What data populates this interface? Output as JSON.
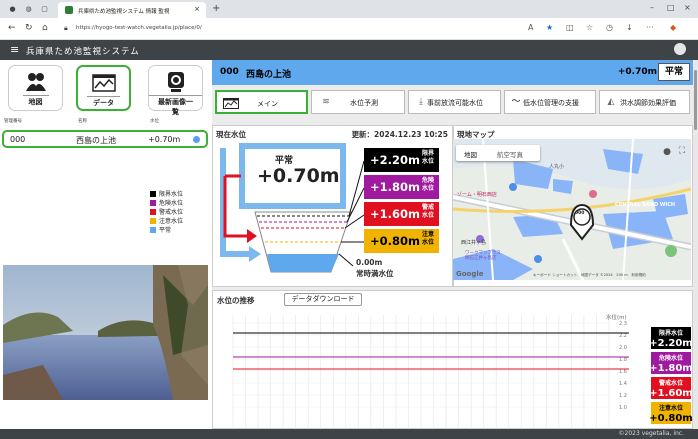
{
  "browser": {
    "tab_title": "兵庫県ため池監視システム 情報 監視",
    "url": "https://hyogo-test-watch.vegetalia.jp/place/0/",
    "url_prefix": "https://",
    "url_host": "hyogo-test-watch.vegetalia.jp/place/0/"
  },
  "app": {
    "title": "兵庫県ため池監視システム"
  },
  "left_nav": {
    "buttons": [
      {
        "label": "地図",
        "icon": "people-map-icon"
      },
      {
        "label": "データ",
        "icon": "data-chart-icon"
      },
      {
        "label": "最新画像一覧",
        "icon": "camera-icon"
      }
    ],
    "columns": [
      "管理番号",
      "名称",
      "水位"
    ],
    "row": {
      "id": "000",
      "name": "西島の上池",
      "level": "+0.70m"
    }
  },
  "legend": [
    {
      "label": "限界水位",
      "color": "#000000"
    },
    {
      "label": "危険水位",
      "color": "#a01aa0"
    },
    {
      "label": "警戒水位",
      "color": "#e01020"
    },
    {
      "label": "注意水位",
      "color": "#f0b400"
    },
    {
      "label": "平常",
      "color": "#5fa8ee"
    }
  ],
  "header": {
    "id": "000",
    "name": "西島の上池",
    "level": "+0.70m",
    "status": "平常"
  },
  "tabs": [
    {
      "label": "メイン",
      "icon": "main-chart-icon"
    },
    {
      "label": "水位予測",
      "icon": "wave-icon"
    },
    {
      "label": "事前放流可能水位",
      "icon": "release-icon"
    },
    {
      "label": "低水位管理の支援",
      "icon": "trend-icon"
    },
    {
      "label": "洪水調節効果評価",
      "icon": "flood-icon"
    }
  ],
  "current": {
    "title": "現在水位",
    "updated": "更新：2024.12.23 10:25",
    "status_label": "平常",
    "value": "+0.70m",
    "base_value": "0.00m",
    "base_label": "常時満水位",
    "levels": [
      {
        "value": "+2.20m",
        "label": "限界 水位",
        "color": "#000000"
      },
      {
        "value": "+1.80m",
        "label": "危険 水位",
        "color": "#a01aa0"
      },
      {
        "value": "+1.60m",
        "label": "警戒 水位",
        "color": "#e01020"
      },
      {
        "value": "+0.80m",
        "label": "注意 水位",
        "color": "#f0b400"
      }
    ]
  },
  "map": {
    "title": "現地マップ",
    "btn_map": "地図",
    "btn_satellite": "航空写真",
    "marker_label": "000",
    "labels": {
      "station": "ゾーム・明石西店",
      "store": "西江井ヶ島",
      "mall": "ワークマンプラス明石江井ヶ島店",
      "sandwich": "CENTRAL SAND WICH",
      "school": "人丸小",
      "attribution": "キーボード ショートカット　地図データ ©2024　200 m　利用規約",
      "google": "Google"
    }
  },
  "chart": {
    "title": "水位の推移",
    "download": "データダウンロード",
    "unit": "水位(m)",
    "ticks": [
      "2.3",
      "2.2",
      "2.0",
      "1.8",
      "1.6",
      "1.4",
      "1.2",
      "1.0"
    ],
    "lines": [
      {
        "label": "限界水位",
        "value": "+2.20m",
        "color": "#000000"
      },
      {
        "label": "危険水位",
        "value": "+1.80m",
        "color": "#a01aa0"
      },
      {
        "label": "警戒水位",
        "value": "+1.60m",
        "color": "#e01020"
      },
      {
        "label": "注意水位",
        "value": "+0.80m",
        "color": "#f0b400"
      }
    ]
  },
  "footer": "©2023 vegetalia, inc."
}
